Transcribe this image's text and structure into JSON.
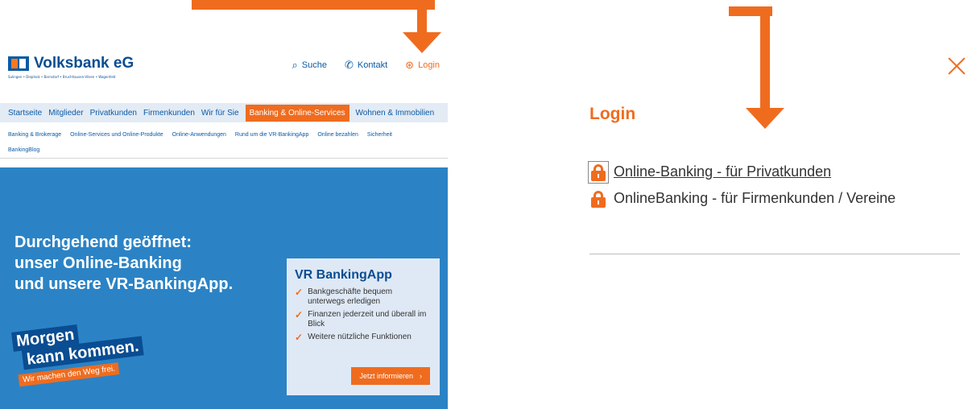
{
  "site": {
    "logo_text": "Volksbank eG",
    "logo_sub": "Sulingen • Diepholz • Barnstorf • Bruchhausen-Vilsen • Wagenfeld",
    "top_actions": {
      "search": "Suche",
      "contact": "Kontakt",
      "login": "Login"
    },
    "mainnav": [
      "Startseite",
      "Mitglieder",
      "Privatkunden",
      "Firmenkunden",
      "Wir für Sie",
      "Banking & Online-Services",
      "Wohnen & Immobilien"
    ],
    "mainnav_active_index": 5,
    "subnav": [
      "Banking & Brokerage",
      "Online-Services und Online-Produkte",
      "Online-Anwendungen",
      "Rund um die VR-BankingApp",
      "Online bezahlen",
      "Sicherheit",
      "BankingBlog"
    ],
    "hero": {
      "headline_1": "Durchgehend geöffnet:",
      "headline_2": "unser Online-Banking",
      "headline_3": "und unsere VR-BankingApp.",
      "morgen_1": "Morgen",
      "morgen_2": "kann kommen.",
      "morgen_3": "Wir machen den Weg frei."
    },
    "card": {
      "title": "VR BankingApp",
      "items": [
        "Bankgeschäfte bequem unterwegs erledigen",
        "Finanzen jederzeit und überall im Blick",
        "Weitere nützliche Funktionen"
      ],
      "button": "Jetzt informieren",
      "button_icon": "chevron-right-icon"
    }
  },
  "panel": {
    "title": "Login",
    "close_icon": "close-icon",
    "links": [
      {
        "label": "Online-Banking - für Privatkunden",
        "icon": "lock-icon"
      },
      {
        "label": "OnlineBanking - für Firmenkunden / Vereine",
        "icon": "lock-icon"
      }
    ]
  },
  "colors": {
    "accent": "#ef6c1f",
    "brand_blue": "#0a4d92",
    "hero_blue": "#2b83c5",
    "nav_bg": "#e3ebf5"
  }
}
